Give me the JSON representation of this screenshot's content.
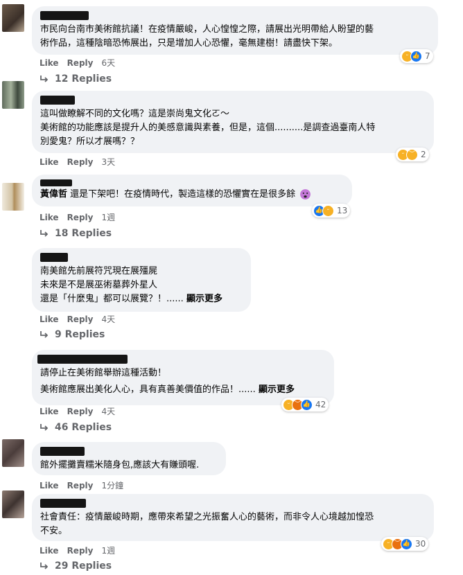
{
  "comments": [
    {
      "name": "",
      "lines": [
        "市民向台南市美術館抗議！在疫情嚴峻，人心惶惶之際，請展出光明帶給人盼望的藝",
        "術作品，這種陰暗恐怖展出，只是增加人心恐懼，毫無建樹！請盡快下架。"
      ],
      "reaction_count": "7",
      "like": "Like",
      "reply": "Reply",
      "time": "6天",
      "replies": "12 Replies"
    },
    {
      "name": "",
      "lines": [
        "這叫做瞭解不同的文化嗎？這是崇尚鬼文化ㄛ～",
        "美術館的功能應該是提升人的美感意識與素養，但是，這個..........是調查過臺南人特",
        "別愛鬼？所以才展嗎？？"
      ],
      "reaction_count": "2",
      "like": "Like",
      "reply": "Reply",
      "time": "3天"
    },
    {
      "name": "黃偉哲",
      "lines": [
        "還是下架吧！在疫情時代，製造這樣的恐懼實在是很多餘"
      ],
      "reaction_count": "13",
      "like": "Like",
      "reply": "Reply",
      "time": "1週",
      "replies": "18 Replies"
    },
    {
      "name": "",
      "lines": [
        "南美館先前展符咒現在展殭屍",
        "未來是不是展巫術墓葬外星人",
        "還是「什麼鬼」都可以展覽？！......"
      ],
      "see_more": "顯示更多",
      "like": "Like",
      "reply": "Reply",
      "time": "4天",
      "replies": "9 Replies"
    },
    {
      "name": "",
      "lines": [
        "請停止在美術館舉辦這種活動！",
        "",
        "美術館應展出美化人心，具有真善美價值的作品！......"
      ],
      "see_more": "顯示更多",
      "reaction_count": "42",
      "like": "Like",
      "reply": "Reply",
      "time": "4天",
      "replies": "46 Replies"
    },
    {
      "name": "",
      "lines": [
        "館外擺攤賣糯米隨身包,應該大有賺頭喔."
      ],
      "like": "Like",
      "reply": "Reply",
      "time": "1分鐘"
    },
    {
      "name": "",
      "lines": [
        "社會責任：疫情嚴峻時期，應帶來希望之光振奮人心的藝術，而非令人心境越加惶恐",
        "不安。"
      ],
      "reaction_count": "30",
      "like": "Like",
      "reply": "Reply",
      "time": "1週",
      "replies": "29 Replies"
    }
  ],
  "colors": {
    "bubble": "#f0f2f5",
    "meta_text": "#65676b",
    "like_blue": "#1877f2",
    "haha_yellow": "#f7b125",
    "angry_orange": "#e9710f"
  },
  "icons": [
    "reply-arrow-icon",
    "haha-reaction-icon",
    "like-reaction-icon",
    "angry-reaction-icon",
    "sad-reaction-icon",
    "wow-face-emoji-icon"
  ]
}
